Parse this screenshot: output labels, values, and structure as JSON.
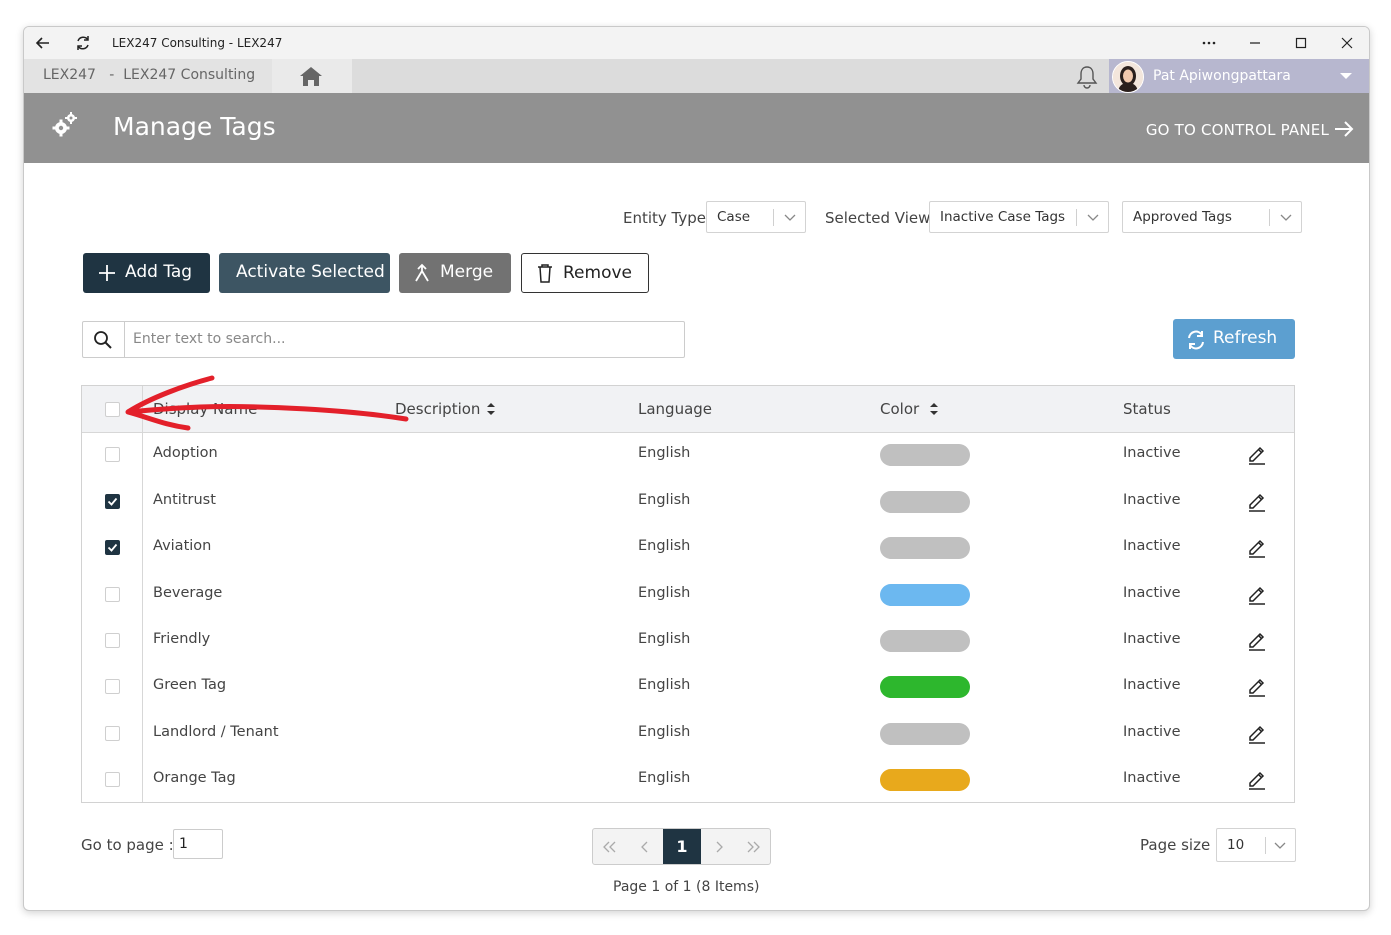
{
  "window": {
    "title": "LEX247 Consulting - LEX247"
  },
  "tabbar": {
    "breadcrumb": "LEX247   -  LEX247 Consulting",
    "user_name": "Pat Apiwongpattara"
  },
  "header": {
    "title": "Manage Tags",
    "control_panel_link": "GO TO CONTROL PANEL"
  },
  "filters": {
    "entity_type_label": "Entity Type",
    "entity_type_value": "Case",
    "selected_view_label": "Selected View",
    "selected_view_value": "Inactive Case Tags",
    "approval_value": "Approved Tags"
  },
  "toolbar": {
    "add_tag": "Add Tag",
    "activate_selected": "Activate Selected",
    "merge": "Merge",
    "remove": "Remove",
    "refresh": "Refresh"
  },
  "search": {
    "placeholder": "Enter text to search..."
  },
  "table": {
    "columns": {
      "display_name": "Display Name",
      "description": "Description",
      "language": "Language",
      "color": "Color",
      "status": "Status"
    },
    "rows": [
      {
        "name": "Adoption",
        "language": "English",
        "color": "#c0c0c0",
        "status": "Inactive",
        "checked": false
      },
      {
        "name": "Antitrust",
        "language": "English",
        "color": "#c0c0c0",
        "status": "Inactive",
        "checked": true
      },
      {
        "name": "Aviation",
        "language": "English",
        "color": "#c0c0c0",
        "status": "Inactive",
        "checked": true
      },
      {
        "name": "Beverage",
        "language": "English",
        "color": "#6cb8f0",
        "status": "Inactive",
        "checked": false
      },
      {
        "name": "Friendly",
        "language": "English",
        "color": "#c0c0c0",
        "status": "Inactive",
        "checked": false
      },
      {
        "name": "Green Tag",
        "language": "English",
        "color": "#2db72d",
        "status": "Inactive",
        "checked": false
      },
      {
        "name": "Landlord / Tenant",
        "language": "English",
        "color": "#c0c0c0",
        "status": "Inactive",
        "checked": false
      },
      {
        "name": "Orange Tag",
        "language": "English",
        "color": "#e8a91c",
        "status": "Inactive",
        "checked": false
      }
    ]
  },
  "pagination": {
    "go_to_page_label": "Go to page :",
    "go_to_page_value": "1",
    "current_page": "1",
    "info": "Page 1 of 1 (8 Items)",
    "page_size_label": "Page size :",
    "page_size_value": "10"
  },
  "annotation_color": "#e3202a"
}
